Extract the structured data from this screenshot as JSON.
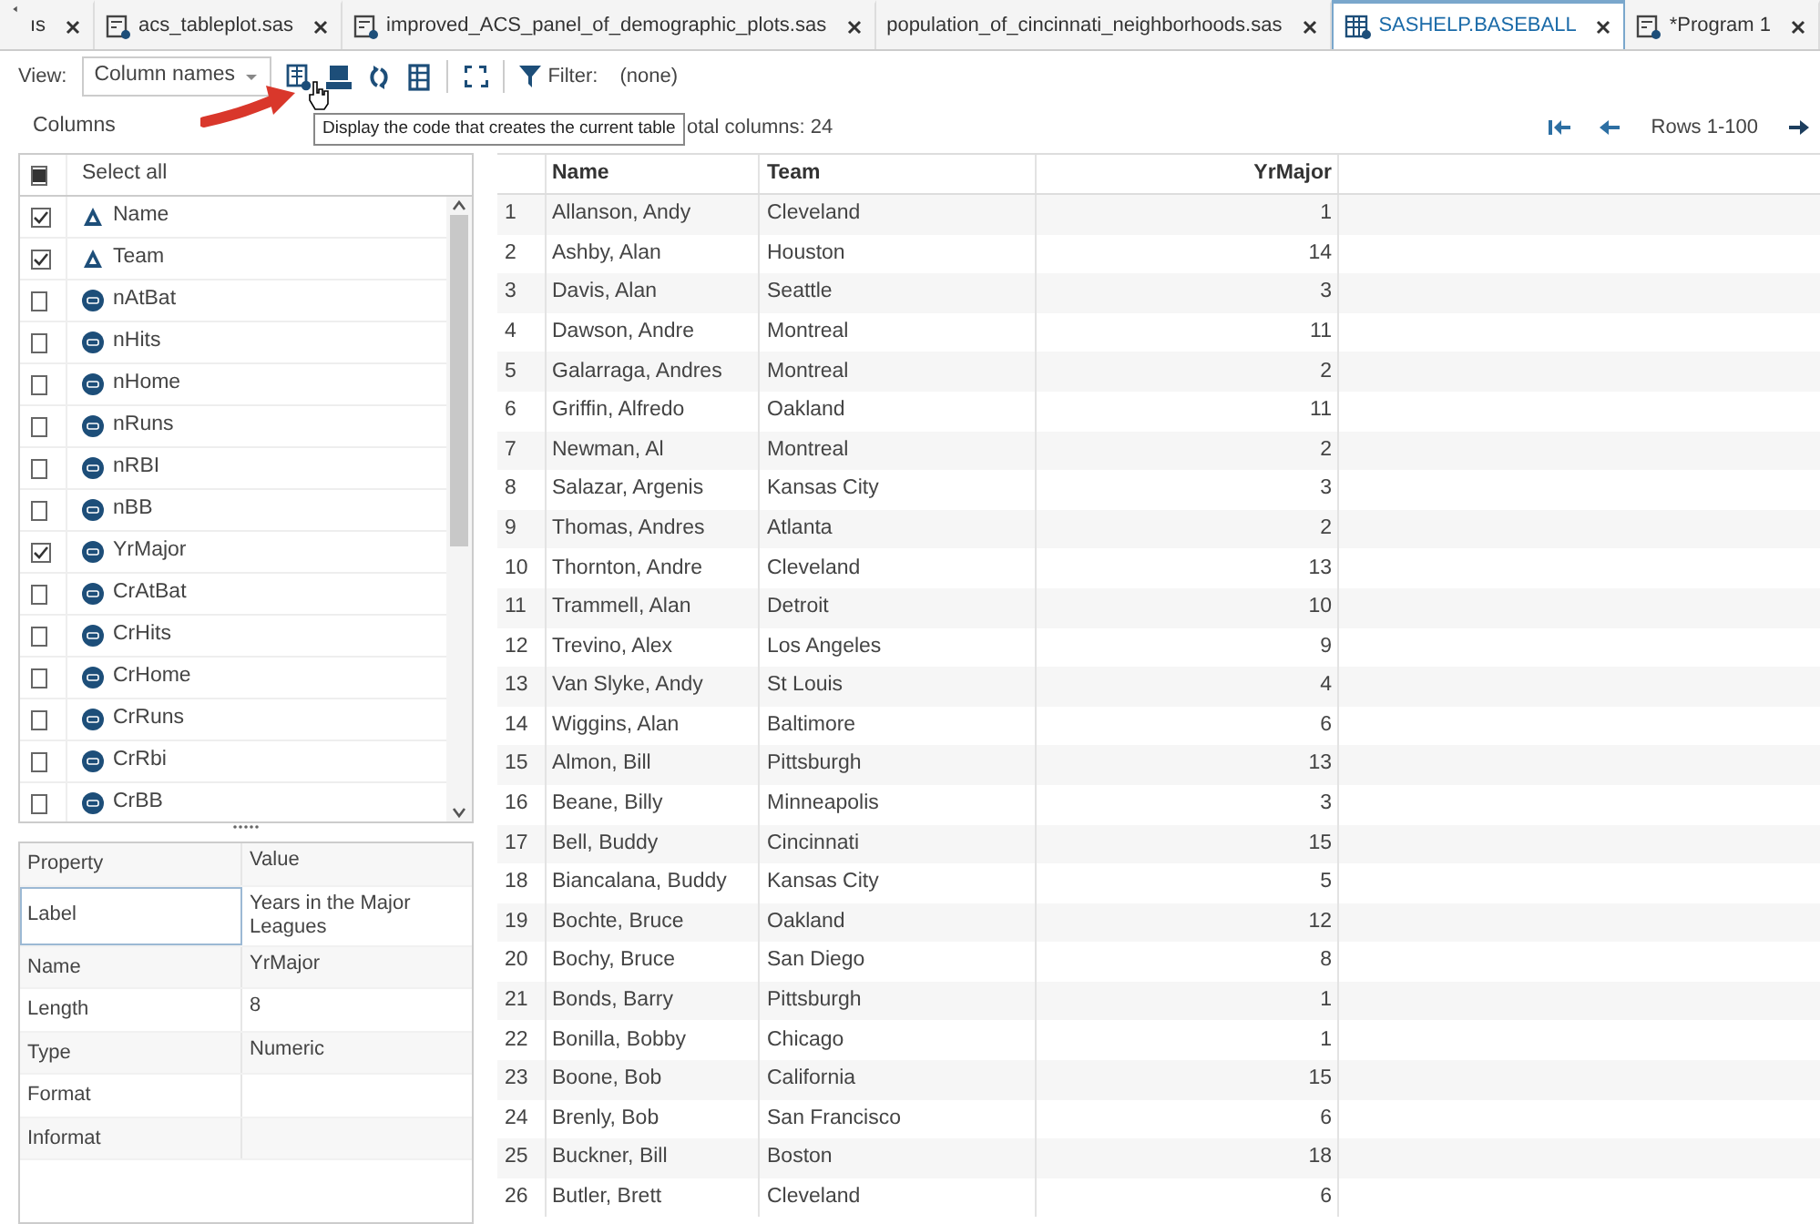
{
  "tabs": [
    {
      "label": "ıs",
      "kind": "plain",
      "selected": false
    },
    {
      "label": "acs_tableplot.sas",
      "kind": "program",
      "selected": false
    },
    {
      "label": "improved_ACS_panel_of_demographic_plots.sas",
      "kind": "program",
      "selected": false
    },
    {
      "label": "population_of_cincinnati_neighborhoods.sas",
      "kind": "plain",
      "selected": false
    },
    {
      "label": "SASHELP.BASEBALL",
      "kind": "table",
      "selected": true
    },
    {
      "label": "*Program 1",
      "kind": "program",
      "selected": false
    }
  ],
  "toolbar": {
    "view_label": "View:",
    "view_select": "Column names",
    "filter_label": "Filter:",
    "filter_value": "(none)",
    "tooltip": "Display the code that creates the current table"
  },
  "columns_panel": {
    "title": "Columns",
    "select_all": {
      "label": "Select all",
      "indeterminate": true
    },
    "items": [
      {
        "name": "Name",
        "kind": "char",
        "checked": true
      },
      {
        "name": "Team",
        "kind": "char",
        "checked": true
      },
      {
        "name": "nAtBat",
        "kind": "num",
        "checked": false
      },
      {
        "name": "nHits",
        "kind": "num",
        "checked": false
      },
      {
        "name": "nHome",
        "kind": "num",
        "checked": false
      },
      {
        "name": "nRuns",
        "kind": "num",
        "checked": false
      },
      {
        "name": "nRBI",
        "kind": "num",
        "checked": false
      },
      {
        "name": "nBB",
        "kind": "num",
        "checked": false
      },
      {
        "name": "YrMajor",
        "kind": "num",
        "checked": true
      },
      {
        "name": "CrAtBat",
        "kind": "num",
        "checked": false
      },
      {
        "name": "CrHits",
        "kind": "num",
        "checked": false
      },
      {
        "name": "CrHome",
        "kind": "num",
        "checked": false
      },
      {
        "name": "CrRuns",
        "kind": "num",
        "checked": false
      },
      {
        "name": "CrRbi",
        "kind": "num",
        "checked": false
      },
      {
        "name": "CrBB",
        "kind": "num",
        "checked": false
      }
    ]
  },
  "properties": {
    "columns": [
      "Property",
      "Value"
    ],
    "rows": [
      {
        "property": "Label",
        "value": "Years in the Major Leagues",
        "selected": true
      },
      {
        "property": "Name",
        "value": "YrMajor",
        "selected": false
      },
      {
        "property": "Length",
        "value": "8",
        "selected": false
      },
      {
        "property": "Type",
        "value": "Numeric",
        "selected": false
      },
      {
        "property": "Format",
        "value": "",
        "selected": false
      },
      {
        "property": "Informat",
        "value": "",
        "selected": false
      }
    ]
  },
  "table": {
    "total_columns": "otal columns: 24",
    "pager": "Rows 1-100",
    "columns": [
      "",
      "Name",
      "Team",
      "YrMajor"
    ],
    "rows": [
      [
        "1",
        "Allanson, Andy",
        "Cleveland",
        "1"
      ],
      [
        "2",
        "Ashby, Alan",
        "Houston",
        "14"
      ],
      [
        "3",
        "Davis, Alan",
        "Seattle",
        "3"
      ],
      [
        "4",
        "Dawson, Andre",
        "Montreal",
        "11"
      ],
      [
        "5",
        "Galarraga, Andres",
        "Montreal",
        "2"
      ],
      [
        "6",
        "Griffin, Alfredo",
        "Oakland",
        "11"
      ],
      [
        "7",
        "Newman, Al",
        "Montreal",
        "2"
      ],
      [
        "8",
        "Salazar, Argenis",
        "Kansas City",
        "3"
      ],
      [
        "9",
        "Thomas, Andres",
        "Atlanta",
        "2"
      ],
      [
        "10",
        "Thornton, Andre",
        "Cleveland",
        "13"
      ],
      [
        "11",
        "Trammell, Alan",
        "Detroit",
        "10"
      ],
      [
        "12",
        "Trevino, Alex",
        "Los Angeles",
        "9"
      ],
      [
        "13",
        "Van Slyke, Andy",
        "St Louis",
        "4"
      ],
      [
        "14",
        "Wiggins, Alan",
        "Baltimore",
        "6"
      ],
      [
        "15",
        "Almon, Bill",
        "Pittsburgh",
        "13"
      ],
      [
        "16",
        "Beane, Billy",
        "Minneapolis",
        "3"
      ],
      [
        "17",
        "Bell, Buddy",
        "Cincinnati",
        "15"
      ],
      [
        "18",
        "Biancalana, Buddy",
        "Kansas City",
        "5"
      ],
      [
        "19",
        "Bochte, Bruce",
        "Oakland",
        "12"
      ],
      [
        "20",
        "Bochy, Bruce",
        "San Diego",
        "8"
      ],
      [
        "21",
        "Bonds, Barry",
        "Pittsburgh",
        "1"
      ],
      [
        "22",
        "Bonilla, Bobby",
        "Chicago",
        "1"
      ],
      [
        "23",
        "Boone, Bob",
        "California",
        "15"
      ],
      [
        "24",
        "Brenly, Bob",
        "San Francisco",
        "6"
      ],
      [
        "25",
        "Buckner, Bill",
        "Boston",
        "18"
      ],
      [
        "26",
        "Butler, Brett",
        "Cleveland",
        "6"
      ]
    ]
  }
}
